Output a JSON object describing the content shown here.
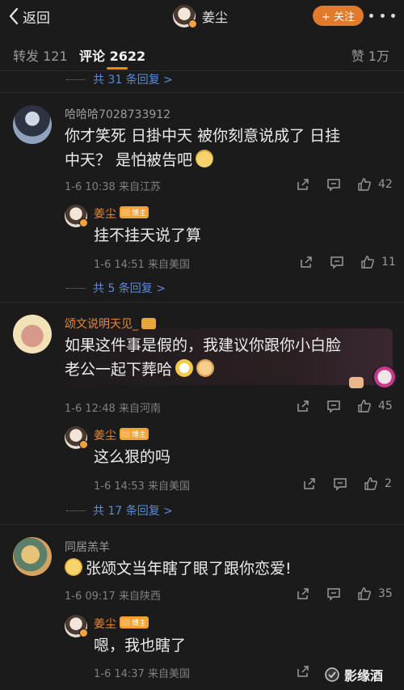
{
  "nav": {
    "back_label": "返回",
    "username": "姜尘",
    "follow_label": "+ 关注"
  },
  "tabs": {
    "repost": "转发 121",
    "comment": "评论 2622",
    "like": "赞 1万"
  },
  "top_replies": "共 31 条回复 >",
  "comments": [
    {
      "username": "哈哈哈7028733912",
      "text_line1": "你才笑死  日掛中天 被你刻意说成了 日挂",
      "text_line2": "中天？  是怕被告吧",
      "meta": "1-6 10:38  来自江苏",
      "likes": "42",
      "reply": {
        "username": "姜尘",
        "badge": "博主",
        "text": "挂不挂天说了算",
        "meta": "1-6 14:51  来自美国",
        "likes": "11"
      },
      "more_replies": "共 5 条回复 >"
    },
    {
      "username": "颂文说明天见_",
      "text_line1": "如果这件事是假的，我建议你跟你小白脸",
      "text_line2": "老公一起下葬哈",
      "meta": "1-6 12:48  来自河南",
      "likes": "45",
      "reply": {
        "username": "姜尘",
        "badge": "博主",
        "text": "这么狠的吗",
        "meta": "1-6 14:53  来自美国",
        "likes": "2"
      },
      "more_replies": "共 17 条回复 >"
    },
    {
      "username": "同居羔羊",
      "text_line1": "张颂文当年瞎了眼了跟你恋爱!",
      "meta": "1-6 09:17  来自陕西",
      "likes": "35",
      "reply": {
        "username": "姜尘",
        "badge": "博主",
        "text": "嗯，我也瞎了",
        "meta": "1-6 14:37  来自美国"
      }
    }
  ],
  "watermark": "影缘酒",
  "colors": {
    "background": "#1b1b1b",
    "accent": "#e27a2b",
    "link": "#5b8bd6",
    "muted": "#808080"
  }
}
